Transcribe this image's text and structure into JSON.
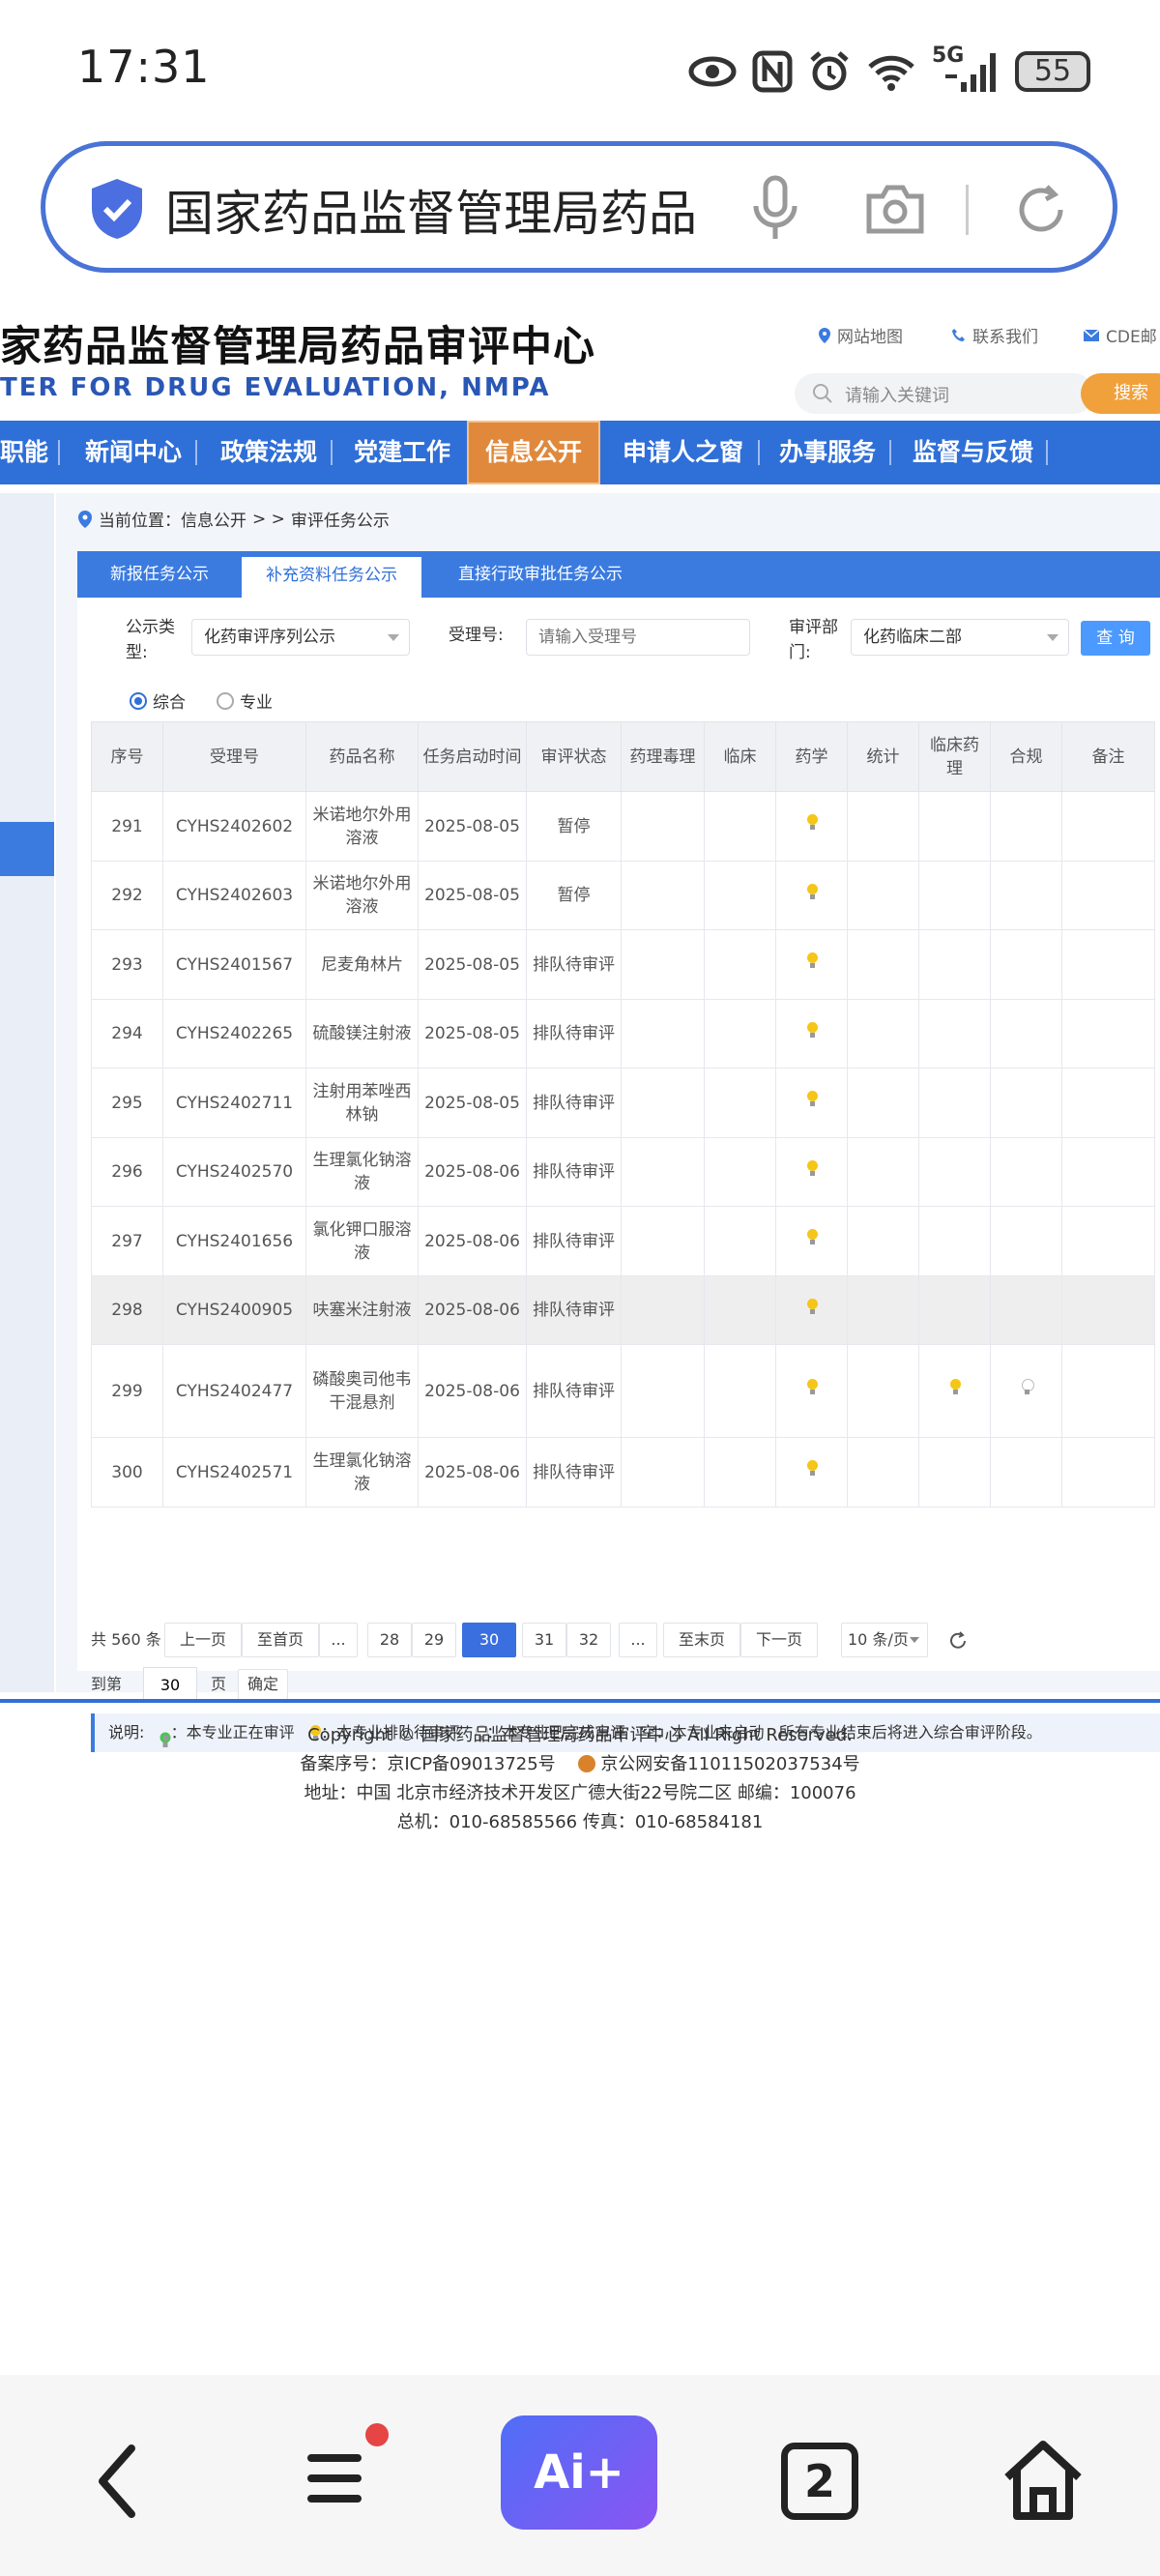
{
  "status_bar": {
    "time": "17:31",
    "battery": "55",
    "network": "5G",
    "icons": [
      "eye-icon",
      "nfc-icon",
      "alarm-icon",
      "wifi-icon",
      "signal-icon",
      "battery-icon"
    ]
  },
  "browser": {
    "url_text": "国家药品监督管理局药品",
    "icons": [
      "shield-check-icon",
      "microphone-icon",
      "camera-icon",
      "reload-icon"
    ]
  },
  "site": {
    "title": "家药品监督管理局药品审评中心",
    "subtitle": "TER FOR DRUG EVALUATION, NMPA",
    "links": {
      "sitemap": "网站地图",
      "contact": "联系我们",
      "mail": "CDE邮"
    },
    "search": {
      "placeholder": "请输入关键词",
      "button": "搜索"
    },
    "nav": [
      "职能",
      "新闻中心",
      "政策法规",
      "党建工作",
      "信息公开",
      "申请人之窗",
      "办事服务",
      "监督与反馈"
    ],
    "nav_active": "信息公开"
  },
  "breadcrumb": {
    "label": "当前位置：信息公开",
    "sep": "> >",
    "current": "审评任务公示"
  },
  "tabs": [
    "新报任务公示",
    "补充资料任务公示",
    "直接行政审批任务公示"
  ],
  "filters": {
    "type_label": "公示类型:",
    "type_value": "化药审评序列公示",
    "accept_label": "受理号:",
    "accept_placeholder": "请输入受理号",
    "dept_label": "审评部门:",
    "dept_value": "化药临床二部",
    "query_button": "查 询",
    "radio_all": "综合",
    "radio_major": "专业"
  },
  "table": {
    "headers": [
      "序号",
      "受理号",
      "药品名称",
      "任务启动时间",
      "审评状态",
      "药理毒理",
      "临床",
      "药学",
      "统计",
      "临床药理",
      "合规",
      "备注"
    ],
    "rows": [
      {
        "no": "291",
        "id": "CYHS2402602",
        "name": "米诺地尔外用溶液",
        "date": "2025-08-05",
        "status": "暂停"
      },
      {
        "no": "292",
        "id": "CYHS2402603",
        "name": "米诺地尔外用溶液",
        "date": "2025-08-05",
        "status": "暂停"
      },
      {
        "no": "293",
        "id": "CYHS2401567",
        "name": "尼麦角林片",
        "date": "2025-08-05",
        "status": "排队待审评"
      },
      {
        "no": "294",
        "id": "CYHS2402265",
        "name": "硫酸镁注射液",
        "date": "2025-08-05",
        "status": "排队待审评"
      },
      {
        "no": "295",
        "id": "CYHS2402711",
        "name": "注射用苯唑西林钠",
        "date": "2025-08-05",
        "status": "排队待审评"
      },
      {
        "no": "296",
        "id": "CYHS2402570",
        "name": "生理氯化钠溶液",
        "date": "2025-08-06",
        "status": "排队待审评"
      },
      {
        "no": "297",
        "id": "CYHS2401656",
        "name": "氯化钾口服溶液",
        "date": "2025-08-06",
        "status": "排队待审评"
      },
      {
        "no": "298",
        "id": "CYHS2400905",
        "name": "呋塞米注射液",
        "date": "2025-08-06",
        "status": "排队待审评"
      },
      {
        "no": "299",
        "id": "CYHS2402477",
        "name": "磷酸奥司他韦干混悬剂",
        "date": "2025-08-06",
        "status": "排队待审评"
      },
      {
        "no": "300",
        "id": "CYHS2402571",
        "name": "生理氯化钠溶液",
        "date": "2025-08-06",
        "status": "排队待审评"
      }
    ]
  },
  "pagination": {
    "total": "共 560 条",
    "prev": "上一页",
    "first": "至首页",
    "ellipsis": "...",
    "pages": [
      "28",
      "29",
      "30",
      "31",
      "32"
    ],
    "current": "30",
    "last": "至末页",
    "next": "下一页",
    "page_size": "10 条/页",
    "goto_label": "到第",
    "goto_value": "30",
    "page_unit": "页",
    "confirm": "确定"
  },
  "legend": {
    "label": "说明:",
    "in_review": "：本专业正在审评",
    "queued": "：本专业排队待审评",
    "done": "：本专业已完成审评",
    "empty": "空：本专业未启动",
    "note": "所有专业结束后将进入综合审评阶段。"
  },
  "footer": {
    "copyright": "Copyright © 国家药品监督管理局药品审评中心   All Right Reserved.",
    "icp": "备案序号：京ICP备09013725号",
    "police": "京公网安备11011502037534号",
    "address": "地址：中国 北京市经济技术开发区广德大街22号院二区     邮编：100076",
    "phone": "总机：010-68585566     传真：010-68584181"
  },
  "bottom_nav": {
    "ai_label": "Ai+",
    "tabs_count": "2",
    "icons": [
      "back-icon",
      "menu-icon",
      "ai-assistant-icon",
      "tabs-icon",
      "home-icon"
    ]
  },
  "colors": {
    "primary": "#2f6fd8",
    "accent": "#e0893c",
    "search": "#f0a13c",
    "bulb_yellow": "#f5c518"
  }
}
